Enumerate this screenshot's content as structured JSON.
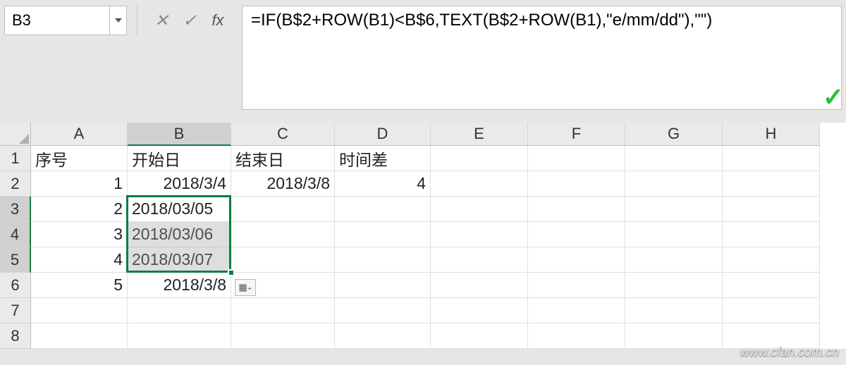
{
  "name_box": "B3",
  "formula": "=IF(B$2+ROW(B1)<B$6,TEXT(B$2+ROW(B1),\"e/mm/dd\"),\"\")",
  "fx_label": "fx",
  "columns": [
    "A",
    "B",
    "C",
    "D",
    "E",
    "F",
    "G",
    "H"
  ],
  "row_headers": [
    "1",
    "2",
    "3",
    "4",
    "5",
    "6",
    "7",
    "8"
  ],
  "selected_range": "B3:B5",
  "cells": {
    "r1": {
      "A": "序号",
      "B": "开始日",
      "C": "结束日",
      "D": "时间差"
    },
    "r2": {
      "A": "1",
      "B": "2018/3/4",
      "C": "2018/3/8",
      "D": "4"
    },
    "r3": {
      "A": "2",
      "B": "2018/03/05"
    },
    "r4": {
      "A": "3",
      "B": "2018/03/06"
    },
    "r5": {
      "A": "4",
      "B": "2018/03/07"
    },
    "r6": {
      "A": "5",
      "B": "2018/3/8"
    }
  },
  "watermark": "www.cfan.com.cn"
}
